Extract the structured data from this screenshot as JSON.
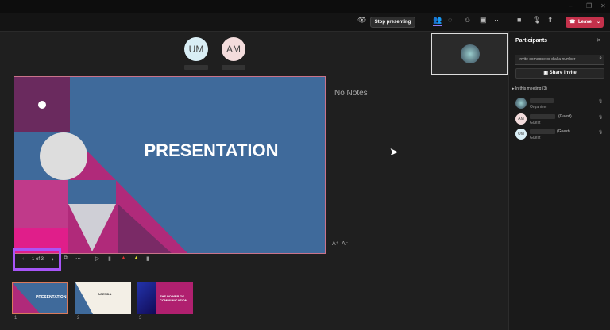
{
  "toolbar": {
    "stop_presenting": "Stop presenting",
    "leave": "Leave"
  },
  "attendees": [
    {
      "initials": "UM",
      "color": "#d9eef5"
    },
    {
      "initials": "AM",
      "color": "#f3dcdc"
    }
  ],
  "slide": {
    "title": "PRESENTATION",
    "counter": "1 of 3",
    "bg": "#3f6a9b"
  },
  "notes": {
    "text": "No Notes",
    "font_up": "A⁺",
    "font_down": "A⁻"
  },
  "thumbnails": [
    {
      "num": "1",
      "title": "PRESENTATION"
    },
    {
      "num": "2",
      "title": "AGENDA"
    },
    {
      "num": "3",
      "title": "THE POWER OF COMMUNICATION"
    }
  ],
  "participants": {
    "title": "Participants",
    "invite_placeholder": "Invite someone or dial a number",
    "share_invite": "Share invite",
    "section": "In this meeting (3)",
    "people": [
      {
        "initials": "",
        "role": "Organizer",
        "suffix": ""
      },
      {
        "initials": "AM",
        "role": "Guest",
        "suffix": "(Guest)"
      },
      {
        "initials": "UM",
        "role": "Guest",
        "suffix": "(Guest)"
      }
    ]
  },
  "colors": {
    "leave": "#c4314b",
    "accent": "#8b5cf6",
    "highlight": "#a855f7"
  }
}
